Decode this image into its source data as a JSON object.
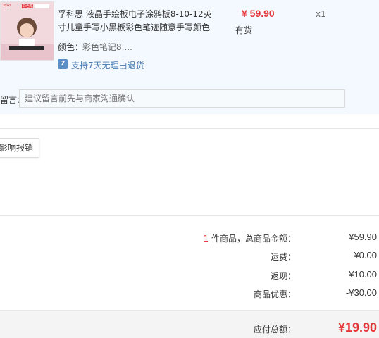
{
  "product": {
    "title": "孚科思 液晶手绘板电子涂鸦板8-10-12英寸儿童手写小黑板彩色笔迹随意手写颜色",
    "price": "¥ 59.90",
    "stock": "有货",
    "quantity": "x1",
    "color_label": "颜色：",
    "color_value": "彩色笔记8....",
    "return_icon": "7",
    "return_policy": "支持7天无理由退货",
    "thumb_brand": "Yowl",
    "thumb_tag": "彩色笔迹"
  },
  "message": {
    "label": "留言:",
    "placeholder": "建议留言前先与商家沟通确认"
  },
  "report_button": "影响报销",
  "summary": {
    "items_count": "1",
    "items_label": " 件商品，总商品金额：",
    "items_total": "¥59.90",
    "shipping_label": "运费：",
    "shipping_value": "¥0.00",
    "cashback_label": "返现：",
    "cashback_value": "-¥10.00",
    "discount_label": "商品优惠：",
    "discount_value": "-¥30.00",
    "total_label": "应付总额：",
    "total_value": "¥19.90"
  },
  "colors": {
    "accent_red": "#e4393c",
    "link_blue": "#4a7ab0",
    "product_bg": "#f3f9fe"
  }
}
